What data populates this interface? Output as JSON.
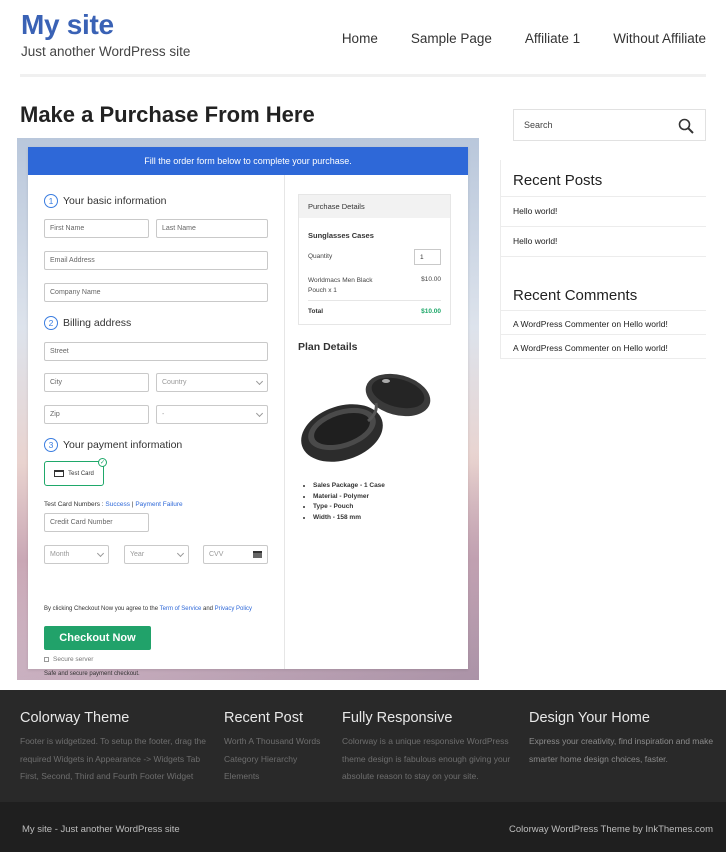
{
  "site": {
    "title": "My site",
    "tagline": "Just another WordPress site"
  },
  "nav": [
    "Home",
    "Sample Page",
    "Affiliate 1",
    "Without Affiliate"
  ],
  "page": {
    "title": "Make a Purchase From Here"
  },
  "form": {
    "banner": "Fill the order form below to complete your purchase.",
    "sections": [
      {
        "number": "1",
        "title": "Your basic information"
      },
      {
        "number": "2",
        "title": "Billing address"
      },
      {
        "number": "3",
        "title": "Your payment information"
      }
    ],
    "fields": {
      "first_name": "First Name",
      "last_name": "Last Name",
      "email": "Email Address",
      "company": "Company Name",
      "street": "Street",
      "city": "City",
      "country": "Country",
      "zip": "Zip",
      "state": "-",
      "credit_card": "Credit Card Number",
      "month": "Month",
      "year": "Year",
      "cvv": "CVV"
    },
    "payment_option": "Test Card",
    "test_numbers_label": "Test Card Numbers :",
    "test_success": "Success",
    "test_sep": "|",
    "test_failure": "Payment Failure",
    "terms_prefix": "By clicking Checkout Now you agree to the",
    "terms_link": "Term of Service",
    "terms_and": "and",
    "privacy_link": "Privacy Policy",
    "checkout_label": "Checkout Now",
    "secure_label": "Secure server",
    "safe_label": "Safe and secure payment checkout."
  },
  "purchase": {
    "header": "Purchase Details",
    "product": "Sunglasses Cases",
    "quantity_label": "Quantity",
    "quantity": "1",
    "item": "Worldmacs Men Black Pouch x 1",
    "item_price": "$10.00",
    "total_label": "Total",
    "total": "$10.00"
  },
  "plan": {
    "title": "Plan Details",
    "features": [
      "Sales Package - 1 Case",
      "Material - Polymer",
      "Type - Pouch",
      "Width - 158 mm"
    ]
  },
  "sidebar": {
    "search_placeholder": "Search",
    "recent_posts_title": "Recent Posts",
    "recent_posts": [
      "Hello world!",
      "Hello world!"
    ],
    "recent_comments_title": "Recent Comments",
    "comments": [
      {
        "author": "A WordPress Commenter",
        "on": "on",
        "post": "Hello world!"
      },
      {
        "author": "A WordPress Commenter",
        "on": "on",
        "post": "Hello world!"
      }
    ]
  },
  "footer": {
    "columns": [
      {
        "title": "Colorway Theme",
        "text": "Footer is widgetized. To setup the footer, drag the required Widgets in Appearance -> Widgets Tab First, Second, Third and Fourth Footer Widget"
      },
      {
        "title": "Recent Post",
        "text": "Worth A Thousand Words Category Hierarchy Elements"
      },
      {
        "title": "Fully Responsive",
        "text": "Colorway is a unique responsive WordPress theme design is fabulous enough giving your absolute reason to stay on your site."
      },
      {
        "title": "Design Your Home",
        "text": "Express your creativity, find inspiration and make smarter home design choices, faster."
      }
    ],
    "bottom_left": "My site - Just another WordPress site",
    "bottom_right": "Colorway WordPress Theme by InkThemes.com"
  },
  "colors": {
    "brand": "#3a62b5",
    "banner": "#2e68d8",
    "checkout": "#21a26a",
    "total": "#1fa86a"
  }
}
